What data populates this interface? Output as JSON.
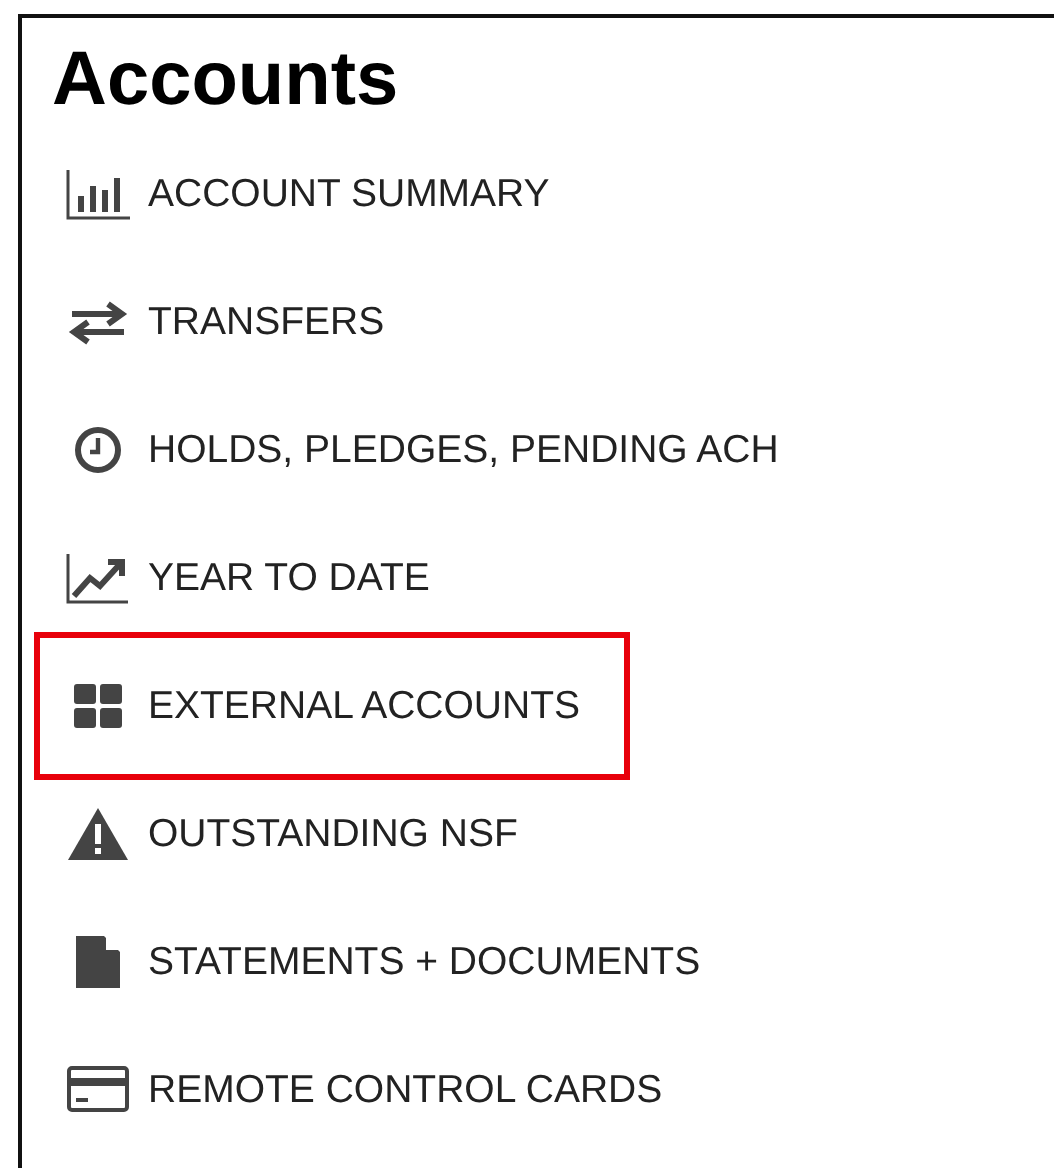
{
  "title": "Accounts",
  "items": [
    {
      "kind": "bar-chart",
      "label": "ACCOUNT SUMMARY",
      "highlighted": false
    },
    {
      "kind": "transfer",
      "label": "TRANSFERS",
      "highlighted": false
    },
    {
      "kind": "clock",
      "label": "HOLDS, PLEDGES, PENDING ACH",
      "highlighted": false
    },
    {
      "kind": "line-chart",
      "label": "YEAR TO DATE",
      "highlighted": false
    },
    {
      "kind": "grid",
      "label": "EXTERNAL ACCOUNTS",
      "highlighted": true
    },
    {
      "kind": "warning",
      "label": "OUTSTANDING NSF",
      "highlighted": false
    },
    {
      "kind": "document",
      "label": "STATEMENTS + DOCUMENTS",
      "highlighted": false
    },
    {
      "kind": "card",
      "label": "REMOTE CONTROL CARDS",
      "highlighted": false
    }
  ]
}
